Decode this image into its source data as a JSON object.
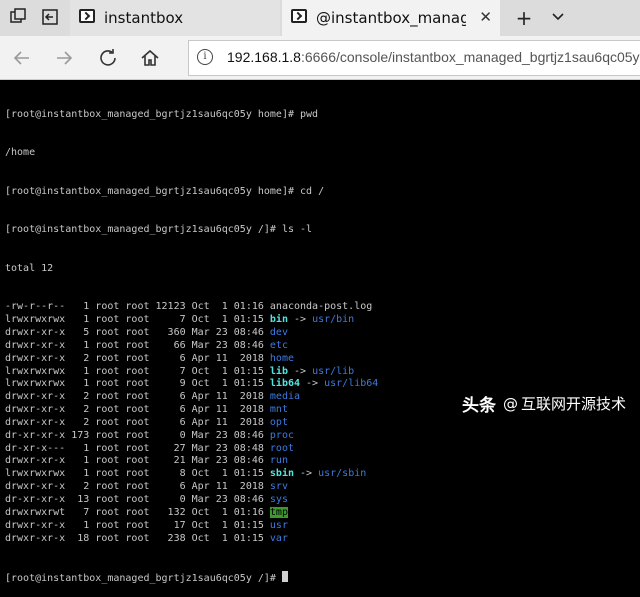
{
  "browser": {
    "tabs": [
      {
        "title": "instantbox",
        "active": false
      },
      {
        "title": "@instantbox_managed_",
        "active": true
      }
    ],
    "new_tab_icon": "plus-icon",
    "menu_icon": "chevron-down-icon",
    "address": {
      "host": "192.168.1.8",
      "path": ":6666/console/instantbox_managed_bgrtjz1sau6qc05y"
    }
  },
  "terminal": {
    "prompt_home": "[root@instantbox_managed_bgrtjz1sau6qc05y home]# ",
    "prompt_root": "[root@instantbox_managed_bgrtjz1sau6qc05y /]# ",
    "cmd_pwd": "pwd",
    "out_pwd": "/home",
    "cmd_cd": "cd /",
    "cmd_ls": "ls -l",
    "total": "total 12",
    "entries": [
      {
        "meta": "-rw-r--r--   1 root root 12123 Oct  1 01:16 ",
        "name": "anaconda-post.log",
        "kind": "plain"
      },
      {
        "meta": "lrwxrwxrwx   1 root root     7 Oct  1 01:15 ",
        "name": "bin",
        "kind": "link",
        "target": "usr/bin"
      },
      {
        "meta": "drwxr-xr-x   5 root root   360 Mar 23 08:46 ",
        "name": "dev",
        "kind": "dir"
      },
      {
        "meta": "drwxr-xr-x   1 root root    66 Mar 23 08:46 ",
        "name": "etc",
        "kind": "dir"
      },
      {
        "meta": "drwxr-xr-x   2 root root     6 Apr 11  2018 ",
        "name": "home",
        "kind": "dir"
      },
      {
        "meta": "lrwxrwxrwx   1 root root     7 Oct  1 01:15 ",
        "name": "lib",
        "kind": "link",
        "target": "usr/lib"
      },
      {
        "meta": "lrwxrwxrwx   1 root root     9 Oct  1 01:15 ",
        "name": "lib64",
        "kind": "link",
        "target": "usr/lib64"
      },
      {
        "meta": "drwxr-xr-x   2 root root     6 Apr 11  2018 ",
        "name": "media",
        "kind": "dir"
      },
      {
        "meta": "drwxr-xr-x   2 root root     6 Apr 11  2018 ",
        "name": "mnt",
        "kind": "dir"
      },
      {
        "meta": "drwxr-xr-x   2 root root     6 Apr 11  2018 ",
        "name": "opt",
        "kind": "dir"
      },
      {
        "meta": "dr-xr-xr-x 173 root root     0 Mar 23 08:46 ",
        "name": "proc",
        "kind": "dir"
      },
      {
        "meta": "dr-xr-x---   1 root root    27 Mar 23 08:48 ",
        "name": "root",
        "kind": "dir"
      },
      {
        "meta": "drwxr-xr-x   1 root root    21 Mar 23 08:46 ",
        "name": "run",
        "kind": "dir"
      },
      {
        "meta": "lrwxrwxrwx   1 root root     8 Oct  1 01:15 ",
        "name": "sbin",
        "kind": "link",
        "target": "usr/sbin"
      },
      {
        "meta": "drwxr-xr-x   2 root root     6 Apr 11  2018 ",
        "name": "srv",
        "kind": "dir"
      },
      {
        "meta": "dr-xr-xr-x  13 root root     0 Mar 23 08:46 ",
        "name": "sys",
        "kind": "dir"
      },
      {
        "meta": "drwxrwxrwt   7 root root   132 Oct  1 01:16 ",
        "name": "tmp",
        "kind": "tmp"
      },
      {
        "meta": "drwxr-xr-x   1 root root    17 Oct  1 01:15 ",
        "name": "usr",
        "kind": "dir"
      },
      {
        "meta": "drwxr-xr-x  18 root root   238 Oct  1 01:15 ",
        "name": "var",
        "kind": "dir"
      }
    ],
    "link_arrow": " -> "
  },
  "watermark": {
    "brand": "头条",
    "at": "@",
    "account": "互联网开源技术"
  },
  "colors": {
    "dir": "#3d7be0",
    "link": "#52e5e0",
    "tmp_bg": "#3a9a2a",
    "terminal_bg": "#000000",
    "terminal_fg": "#c8c8c8"
  }
}
